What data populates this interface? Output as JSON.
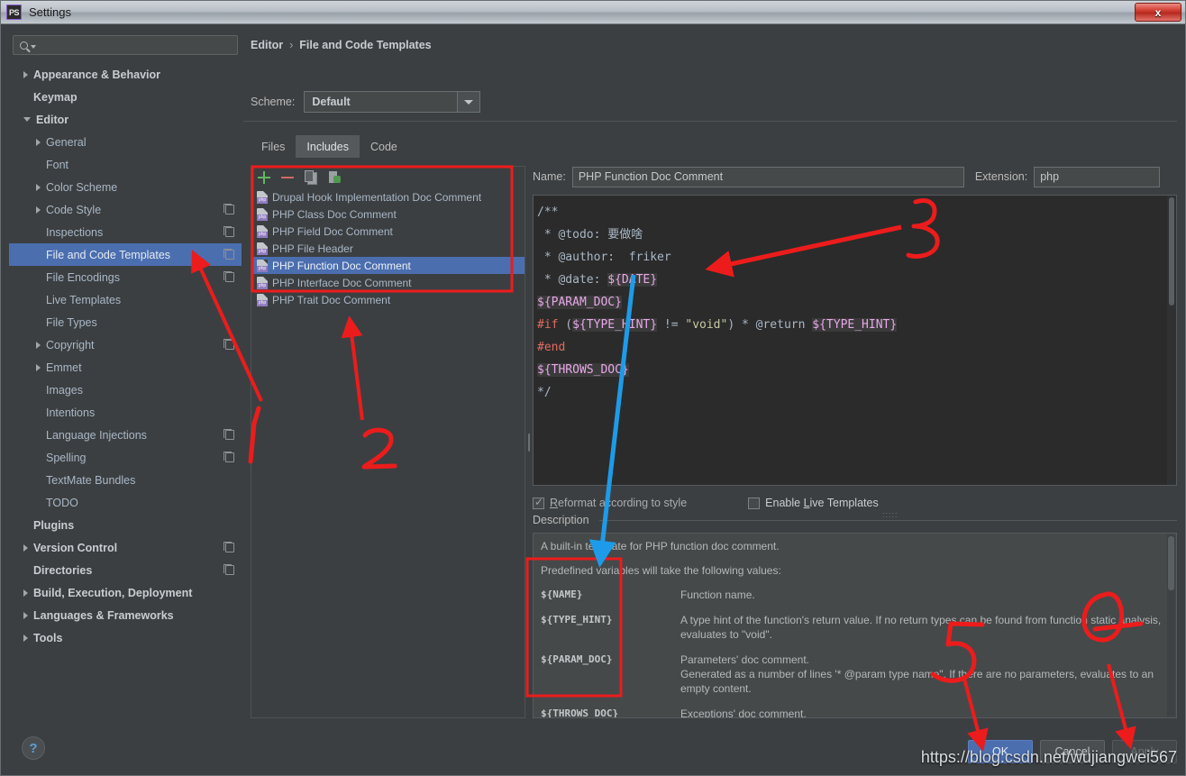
{
  "window": {
    "title": "Settings",
    "app_icon": "phpstorm-icon",
    "close_label": "x"
  },
  "search": {
    "placeholder": "",
    "value": "",
    "icon": "search-icon"
  },
  "sidebar": {
    "items": [
      {
        "label": "Appearance & Behavior",
        "level": 0,
        "arrow": "right",
        "bold": true,
        "copy": false,
        "selected": false
      },
      {
        "label": "Keymap",
        "level": 0,
        "arrow": "none",
        "bold": true,
        "copy": false,
        "selected": false
      },
      {
        "label": "Editor",
        "level": 0,
        "arrow": "down",
        "bold": true,
        "copy": false,
        "selected": false
      },
      {
        "label": "General",
        "level": 1,
        "arrow": "right",
        "bold": false,
        "copy": false,
        "selected": false
      },
      {
        "label": "Font",
        "level": 1,
        "arrow": "none",
        "bold": false,
        "copy": false,
        "selected": false
      },
      {
        "label": "Color Scheme",
        "level": 1,
        "arrow": "right",
        "bold": false,
        "copy": false,
        "selected": false
      },
      {
        "label": "Code Style",
        "level": 1,
        "arrow": "right",
        "bold": false,
        "copy": true,
        "selected": false
      },
      {
        "label": "Inspections",
        "level": 1,
        "arrow": "none",
        "bold": false,
        "copy": true,
        "selected": false
      },
      {
        "label": "File and Code Templates",
        "level": 1,
        "arrow": "none",
        "bold": false,
        "copy": true,
        "selected": true
      },
      {
        "label": "File Encodings",
        "level": 1,
        "arrow": "none",
        "bold": false,
        "copy": true,
        "selected": false
      },
      {
        "label": "Live Templates",
        "level": 1,
        "arrow": "none",
        "bold": false,
        "copy": false,
        "selected": false
      },
      {
        "label": "File Types",
        "level": 1,
        "arrow": "none",
        "bold": false,
        "copy": false,
        "selected": false
      },
      {
        "label": "Copyright",
        "level": 1,
        "arrow": "right",
        "bold": false,
        "copy": true,
        "selected": false
      },
      {
        "label": "Emmet",
        "level": 1,
        "arrow": "right",
        "bold": false,
        "copy": false,
        "selected": false
      },
      {
        "label": "Images",
        "level": 1,
        "arrow": "none",
        "bold": false,
        "copy": false,
        "selected": false
      },
      {
        "label": "Intentions",
        "level": 1,
        "arrow": "none",
        "bold": false,
        "copy": false,
        "selected": false
      },
      {
        "label": "Language Injections",
        "level": 1,
        "arrow": "none",
        "bold": false,
        "copy": true,
        "selected": false
      },
      {
        "label": "Spelling",
        "level": 1,
        "arrow": "none",
        "bold": false,
        "copy": true,
        "selected": false
      },
      {
        "label": "TextMate Bundles",
        "level": 1,
        "arrow": "none",
        "bold": false,
        "copy": false,
        "selected": false
      },
      {
        "label": "TODO",
        "level": 1,
        "arrow": "none",
        "bold": false,
        "copy": false,
        "selected": false
      },
      {
        "label": "Plugins",
        "level": 0,
        "arrow": "none",
        "bold": true,
        "copy": false,
        "selected": false
      },
      {
        "label": "Version Control",
        "level": 0,
        "arrow": "right",
        "bold": true,
        "copy": true,
        "selected": false
      },
      {
        "label": "Directories",
        "level": 0,
        "arrow": "none",
        "bold": true,
        "copy": true,
        "selected": false
      },
      {
        "label": "Build, Execution, Deployment",
        "level": 0,
        "arrow": "right",
        "bold": true,
        "copy": false,
        "selected": false
      },
      {
        "label": "Languages & Frameworks",
        "level": 0,
        "arrow": "right",
        "bold": true,
        "copy": false,
        "selected": false
      },
      {
        "label": "Tools",
        "level": 0,
        "arrow": "right",
        "bold": true,
        "copy": false,
        "selected": false
      }
    ],
    "help_label": "?"
  },
  "breadcrumb": {
    "parent": "Editor",
    "separator": "›",
    "current": "File and Code Templates"
  },
  "scheme": {
    "label": "Scheme:",
    "value": "Default"
  },
  "tabs": [
    {
      "label": "Files",
      "active": false
    },
    {
      "label": "Includes",
      "active": true
    },
    {
      "label": "Code",
      "active": false
    }
  ],
  "list_toolbar": [
    {
      "name": "add-icon",
      "label": "+"
    },
    {
      "name": "remove-icon",
      "label": "−"
    },
    {
      "name": "copy-icon",
      "label": ""
    },
    {
      "name": "reset-icon",
      "label": ""
    }
  ],
  "templates": [
    {
      "label": "Drupal Hook Implementation Doc Comment",
      "selected": false
    },
    {
      "label": "PHP Class Doc Comment",
      "selected": false
    },
    {
      "label": "PHP Field Doc Comment",
      "selected": false
    },
    {
      "label": "PHP File Header",
      "selected": false
    },
    {
      "label": "PHP Function Doc Comment",
      "selected": true
    },
    {
      "label": "PHP Interface Doc Comment",
      "selected": false
    },
    {
      "label": "PHP Trait Doc Comment",
      "selected": false
    }
  ],
  "editor": {
    "name_label": "Name:",
    "name_value": "PHP Function Doc Comment",
    "extension_label": "Extension:",
    "extension_value": "php",
    "code_lines": [
      "/**",
      " * @todo: 要做啥",
      " * @author:  friker",
      " * @date: ${DATE}",
      "${PARAM_DOC}",
      "#if (${TYPE_HINT} != \"void\") * @return ${TYPE_HINT}",
      "#end",
      "${THROWS_DOC}",
      "*/"
    ]
  },
  "options": {
    "reformat_label": "Reformat according to style",
    "reformat_checked": true,
    "live_templates_label": "Enable Live Templates",
    "live_templates_checked": false
  },
  "description": {
    "title": "Description",
    "paragraph1": "A built-in template for PHP function doc comment.",
    "paragraph2": "Predefined variables will take the following values:",
    "variables": [
      {
        "name": "${NAME}",
        "desc": "Function name."
      },
      {
        "name": "${TYPE_HINT}",
        "desc": "A type hint of the function's return value. If no return types can be found from function static analysis, evaluates to \"void\"."
      },
      {
        "name": "${PARAM_DOC}",
        "desc": "Parameters' doc comment.\nGenerated as a number of lines '* @param type name\". If there are no parameters, evaluates to an empty content."
      },
      {
        "name": "${THROWS_DOC}",
        "desc": "Exceptions' doc comment.\nGenerated as a number of lines '* @throws type\". If there are no thrown exceptions, evaluates to an empty content."
      }
    ]
  },
  "footer": {
    "ok_label": "OK",
    "cancel_label": "Cancel",
    "apply_label": "Apply"
  },
  "watermark": "https://blog.csdn.net/wujiangwei567",
  "annotations": {
    "color": "#ec1c1c",
    "arrow_blue": "#1e9be8",
    "numbers": [
      "1",
      "2",
      "3",
      "4",
      "5"
    ]
  }
}
